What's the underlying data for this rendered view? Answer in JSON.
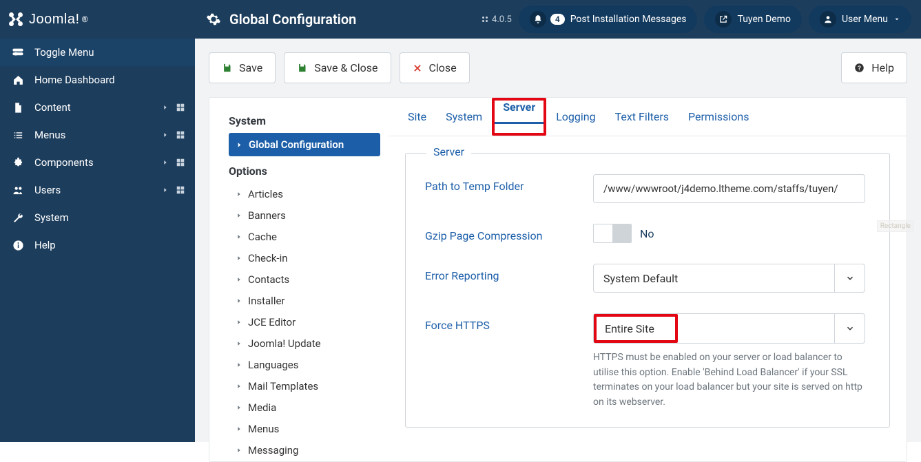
{
  "brand": "Joomla!",
  "page_title": "Global Configuration",
  "version": "4.0.5",
  "top": {
    "notif_count": "4",
    "notif_label": "Post Installation Messages",
    "site_link": "Tuyen Demo",
    "user_menu": "User Menu"
  },
  "sidebar": {
    "toggle": "Toggle Menu",
    "items": [
      {
        "label": "Home Dashboard",
        "icon": "home",
        "expand": false,
        "grid": false
      },
      {
        "label": "Content",
        "icon": "file",
        "expand": true,
        "grid": true
      },
      {
        "label": "Menus",
        "icon": "list",
        "expand": true,
        "grid": true
      },
      {
        "label": "Components",
        "icon": "puzzle",
        "expand": true,
        "grid": true
      },
      {
        "label": "Users",
        "icon": "users",
        "expand": true,
        "grid": true
      },
      {
        "label": "System",
        "icon": "wrench",
        "expand": false,
        "grid": false
      },
      {
        "label": "Help",
        "icon": "info",
        "expand": false,
        "grid": false
      }
    ]
  },
  "toolbar": {
    "save": "Save",
    "save_close": "Save & Close",
    "close": "Close",
    "help": "Help"
  },
  "panel_left": {
    "system_head": "System",
    "active": "Global Configuration",
    "options_head": "Options",
    "options": [
      "Articles",
      "Banners",
      "Cache",
      "Check-in",
      "Contacts",
      "Installer",
      "JCE Editor",
      "Joomla! Update",
      "Languages",
      "Mail Templates",
      "Media",
      "Menus",
      "Messaging"
    ]
  },
  "tabs": [
    "Site",
    "System",
    "Server",
    "Logging",
    "Text Filters",
    "Permissions"
  ],
  "fieldset": {
    "legend": "Server",
    "path_label": "Path to Temp Folder",
    "path_value": "/www/wwwroot/j4demo.ltheme.com/staffs/tuyen/",
    "gzip_label": "Gzip Page Compression",
    "gzip_value": "No",
    "error_label": "Error Reporting",
    "error_value": "System Default",
    "https_label": "Force HTTPS",
    "https_value": "Entire Site",
    "https_desc": "HTTPS must be enabled on your server or load balancer to utilise this option. Enable 'Behind Load Balancer' if your SSL terminates on your load balancer but your site is served on http on its webserver."
  },
  "watermark": "Rectangle"
}
